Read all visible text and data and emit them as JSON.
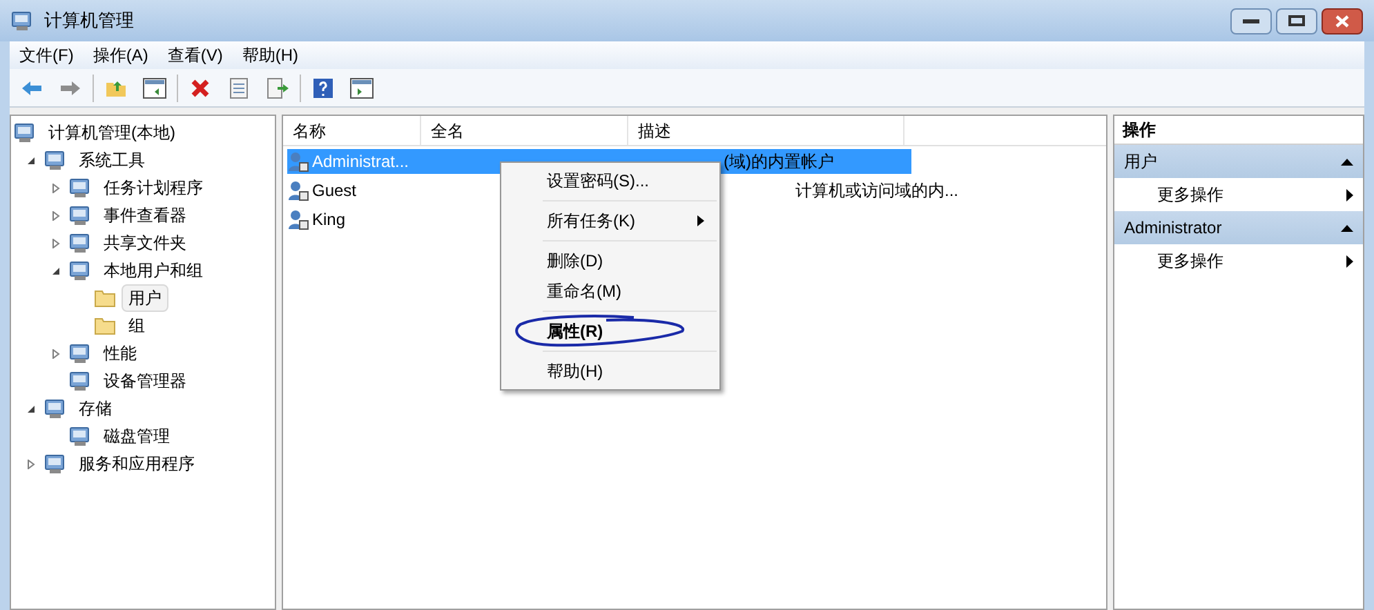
{
  "window": {
    "title": "计算机管理"
  },
  "menu_bar": [
    "文件(F)",
    "操作(A)",
    "查看(V)",
    "帮助(H)"
  ],
  "tree": [
    {
      "label": "计算机管理(本地)",
      "selected": false,
      "children": [
        {
          "label": "系统工具",
          "selected": false,
          "expanded": true,
          "children": [
            {
              "label": "任务计划程序",
              "selected": false,
              "expanded": false
            },
            {
              "label": "事件查看器",
              "selected": false,
              "expanded": false
            },
            {
              "label": "共享文件夹",
              "selected": false,
              "expanded": false
            },
            {
              "label": "本地用户和组",
              "selected": false,
              "expanded": true,
              "children": [
                {
                  "label": "用户",
                  "selected": true
                },
                {
                  "label": "组",
                  "selected": false
                }
              ]
            },
            {
              "label": "性能",
              "selected": false,
              "expanded": false
            },
            {
              "label": "设备管理器",
              "selected": false
            }
          ]
        },
        {
          "label": "存储",
          "selected": false,
          "expanded": true,
          "children": [
            {
              "label": "磁盘管理",
              "selected": false
            }
          ]
        },
        {
          "label": "服务和应用程序",
          "selected": false,
          "expanded": false
        }
      ]
    }
  ],
  "table": {
    "columns": [
      "名称",
      "全名",
      "描述"
    ],
    "rows": [
      {
        "name": "Administrat...",
        "description": "(域)的内置帐户",
        "selected": true
      },
      {
        "name": "Guest",
        "description": "计算机或访问域的内...",
        "selected": false
      },
      {
        "name": "King",
        "selected": false
      }
    ]
  },
  "context_menu": [
    {
      "kind": "item",
      "label": "设置密码(S)..."
    },
    {
      "kind": "separator"
    },
    {
      "kind": "submenu",
      "label": "所有任务(K)"
    },
    {
      "kind": "separator"
    },
    {
      "kind": "item",
      "label": "删除(D)"
    },
    {
      "kind": "item",
      "label": "重命名(M)"
    },
    {
      "kind": "separator"
    },
    {
      "kind": "default",
      "label": "属性(R)",
      "circled": true
    },
    {
      "kind": "separator"
    },
    {
      "kind": "item",
      "label": "帮助(H)"
    }
  ],
  "actions": {
    "title": "操作",
    "sections": [
      {
        "title": "用户",
        "items": [
          "更多操作"
        ]
      },
      {
        "title": "Administrator",
        "items": [
          "更多操作"
        ]
      }
    ]
  }
}
